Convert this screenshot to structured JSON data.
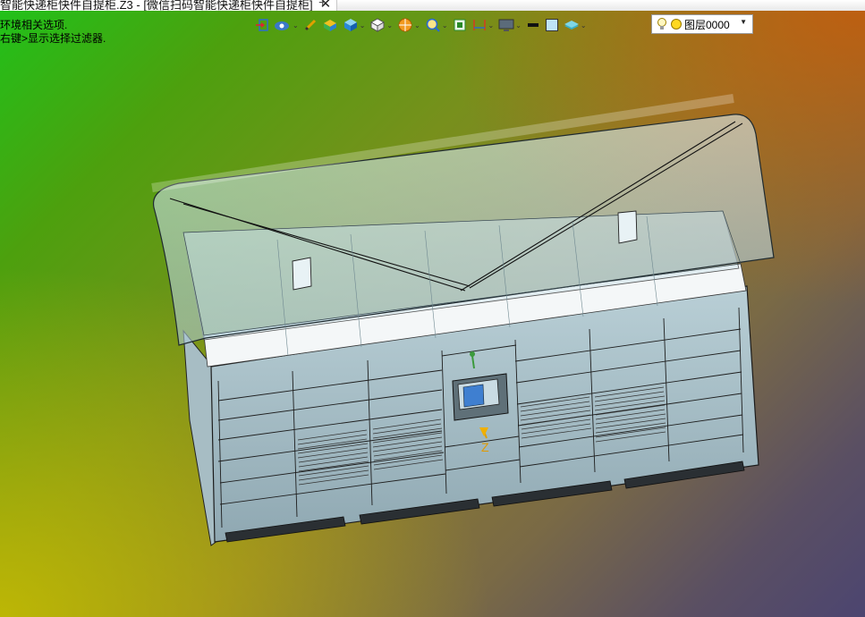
{
  "tab": {
    "title": "智能快递柜快件自提柜.Z3 - [微信扫码智能快递柜快件自提柜]",
    "close": "✕",
    "add": "+"
  },
  "hints": [
    "环境相关选项.",
    "右键>显示选择过滤器."
  ],
  "toolbar": {
    "icons": [
      "exit-icon",
      "view-orient-icon",
      "pencil-icon",
      "shaded-box-icon",
      "cube-icon",
      "wire-cube-icon",
      "render-style-icon",
      "zoom-icon",
      "fit-view-icon",
      "dimension-icon",
      "display-icon",
      "line-color-icon",
      "fill-color-icon",
      "layer-style-icon"
    ]
  },
  "layer": {
    "label": "图层0000",
    "dropdown": "▼"
  },
  "axis": {
    "z_label": "Z"
  },
  "colors": {
    "panel": "#9fb4bc",
    "glass": "#c6dde6",
    "door": "#93acb6"
  }
}
